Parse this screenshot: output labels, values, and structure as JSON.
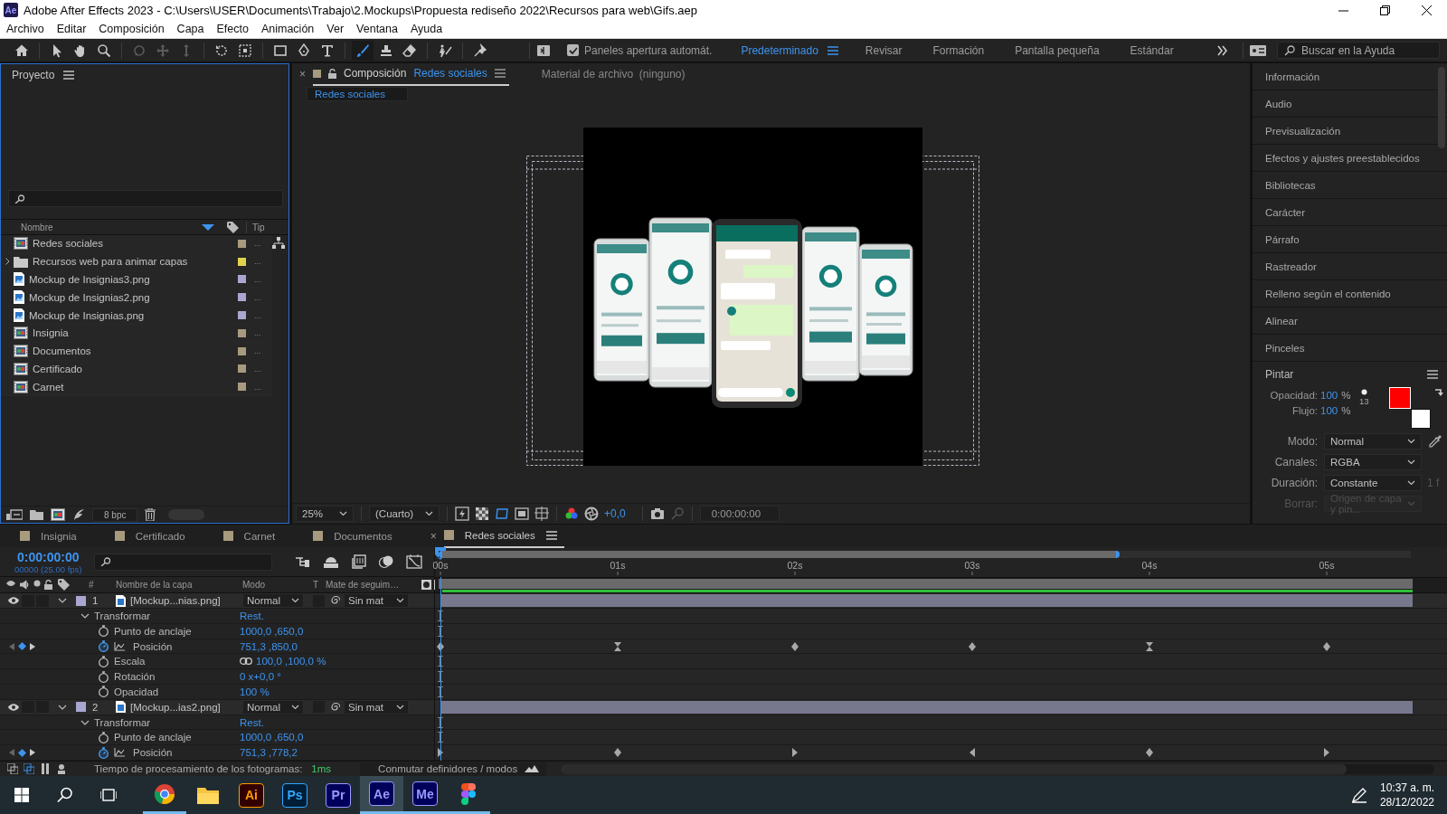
{
  "window": {
    "app_badge": "Ae",
    "title": "Adobe After Effects 2023 - C:\\Users\\USER\\Documents\\Trabajo\\2.Mockups\\Propuesta rediseño 2022\\Recursos para web\\Gifs.aep"
  },
  "menu": [
    "Archivo",
    "Editar",
    "Composición",
    "Capa",
    "Efecto",
    "Animación",
    "Ver",
    "Ventana",
    "Ayuda"
  ],
  "toolbar": {
    "tools": [
      {
        "kind": "home",
        "selected": false,
        "disabled": false
      },
      {
        "kind": "selection",
        "selected": false,
        "disabled": false
      },
      {
        "kind": "hand",
        "selected": false,
        "disabled": false
      },
      {
        "kind": "zoom",
        "selected": false,
        "disabled": false
      },
      {
        "kind": "orbit",
        "selected": false,
        "disabled": true
      },
      {
        "kind": "pan",
        "selected": false,
        "disabled": true
      },
      {
        "kind": "dolly",
        "selected": false,
        "disabled": true
      },
      {
        "kind": "rotate",
        "selected": false,
        "disabled": false
      },
      {
        "kind": "pan-behind",
        "selected": false,
        "disabled": false
      },
      {
        "kind": "rectangle",
        "selected": false,
        "disabled": false
      },
      {
        "kind": "pen",
        "selected": false,
        "disabled": false
      },
      {
        "kind": "type",
        "selected": false,
        "disabled": false
      },
      {
        "kind": "brush",
        "selected": true,
        "disabled": false
      },
      {
        "kind": "stamp",
        "selected": false,
        "disabled": false
      },
      {
        "kind": "eraser",
        "selected": false,
        "disabled": false
      },
      {
        "kind": "roto",
        "selected": false,
        "disabled": false
      },
      {
        "kind": "puppet",
        "selected": false,
        "disabled": false
      }
    ],
    "auto_open": {
      "label": "Paneles apertura automát.",
      "checked": true
    },
    "workspaces": [
      {
        "label": "Predeterminado",
        "selected": true
      },
      {
        "label": "Revisar",
        "selected": false
      },
      {
        "label": "Formación",
        "selected": false
      },
      {
        "label": "Pantalla pequeña",
        "selected": false
      },
      {
        "label": "Estándar",
        "selected": false
      }
    ],
    "search": {
      "placeholder": "Buscar en la Ayuda"
    }
  },
  "project": {
    "title": "Proyecto",
    "columns": [
      "Nombre",
      "Tip"
    ],
    "bit_depth": "8 bpc",
    "thumbnail_slider": {
      "level": 1
    },
    "items": [
      {
        "name": "Redes sociales",
        "kind": "composition",
        "color": "#a89a7e",
        "type": "...",
        "expandable": false
      },
      {
        "name": "Recursos web para animar capas",
        "kind": "folder",
        "color": "#e2d34c",
        "type": "...",
        "expandable": true
      },
      {
        "name": "Mockup de Insignias3.png",
        "kind": "image",
        "color": "#aaa6d2",
        "type": "...",
        "expandable": false
      },
      {
        "name": "Mockup de Insignias2.png",
        "kind": "image",
        "color": "#aaa6d2",
        "type": "...",
        "expandable": false
      },
      {
        "name": "Mockup de Insignias.png",
        "kind": "image",
        "color": "#aaa6d2",
        "type": "...",
        "expandable": false
      },
      {
        "name": "Insignia",
        "kind": "composition",
        "color": "#a89a7e",
        "type": "...",
        "expandable": false
      },
      {
        "name": "Documentos",
        "kind": "composition",
        "color": "#a89a7e",
        "type": "...",
        "expandable": false
      },
      {
        "name": "Certificado",
        "kind": "composition",
        "color": "#a89a7e",
        "type": "...",
        "expandable": false
      },
      {
        "name": "Carnet",
        "kind": "composition",
        "color": "#a89a7e",
        "type": "...",
        "expandable": false
      }
    ]
  },
  "composition": {
    "close": "×",
    "tab": {
      "label": "Composición",
      "name": "Redes sociales",
      "color": "#a89a7e"
    },
    "footage_tab": "Material de archivo  (ninguno)",
    "breadcrumb": "Redes sociales",
    "viewer": {
      "zoom": "25%",
      "resolution": "(Cuarto)",
      "exposure": "+0,0",
      "timecode": "0:00:00:00"
    }
  },
  "panels": {
    "items": [
      "Información",
      "Audio",
      "Previsualización",
      "Efectos y ajustes preestablecidos",
      "Bibliotecas",
      "Carácter",
      "Párrafo",
      "Rastreador",
      "Relleno según el contenido",
      "Alinear",
      "Pinceles"
    ],
    "paint": {
      "title": "Pintar",
      "opacity_label": "Opacidad:",
      "opacity": "100",
      "flow_label": "Flujo:",
      "flow": "100",
      "unit": "%",
      "brush_size": "13",
      "colors": [
        {
          "kind": "foreground",
          "color": "#ff0000"
        },
        {
          "kind": "background",
          "color": "#ffffff"
        }
      ],
      "fields": [
        {
          "label": "Modo:",
          "value": "Normal",
          "disabled": false
        },
        {
          "label": "Canales:",
          "value": "RGBA",
          "disabled": false
        },
        {
          "label": "Duración:",
          "value": "Constante",
          "suffix": "1 f",
          "disabled": false
        },
        {
          "label": "Borrar:",
          "value": "Origen de capa y pin...",
          "disabled": true
        }
      ]
    }
  },
  "timeline": {
    "tabs": [
      {
        "label": "Insignia",
        "color": "#a89a7e",
        "selected": false
      },
      {
        "label": "Certificado",
        "color": "#a89a7e",
        "selected": false
      },
      {
        "label": "Carnet",
        "color": "#a89a7e",
        "selected": false
      },
      {
        "label": "Documentos",
        "color": "#a89a7e",
        "selected": false
      },
      {
        "label": "Redes sociales",
        "color": "#a89a7e",
        "selected": true,
        "close": "×"
      }
    ],
    "timecode": "0:00:00:00",
    "frame_info": "00000 (25.00 fps)",
    "columns": {
      "number": "#",
      "name": "Nombre de la capa",
      "mode": "Modo",
      "t": "T",
      "matte": "Mate de seguim…"
    },
    "ruler": [
      "00s",
      "01s",
      "02s",
      "03s",
      "04s",
      "05s"
    ],
    "navigator": {
      "level": 0.7
    },
    "layers": [
      {
        "number": "1",
        "name": "[Mockup...nias.png]",
        "color": "#aaa6d2",
        "visible": true,
        "expanded": true,
        "mode": "Normal",
        "matte": "Sin mat",
        "children": [
          {
            "name": "Transformar",
            "value": "Rest.",
            "expanded": true,
            "keys": [
              {
                "kind": "bar"
              }
            ],
            "children": [
              {
                "name": "Punto de anclaje",
                "value": "1000,0 ,650,0",
                "animated": false,
                "keys": [
                  {
                    "kind": "bar"
                  }
                ]
              },
              {
                "name": "Posición",
                "value": "751,3 ,850,0",
                "animated": true,
                "keys": [
                  {
                    "kind": "diamond"
                  },
                  {
                    "kind": "hourglass"
                  },
                  {
                    "kind": "diamond"
                  },
                  {
                    "kind": "diamond"
                  },
                  {
                    "kind": "hourglass"
                  },
                  {
                    "kind": "diamond"
                  }
                ]
              },
              {
                "name": "Escala",
                "value": "100,0 ,100,0 %",
                "animated": false,
                "linked": true,
                "keys": [
                  {
                    "kind": "bar"
                  }
                ]
              },
              {
                "name": "Rotación",
                "value": "0 x+0,0 °",
                "animated": false,
                "keys": [
                  {
                    "kind": "bar"
                  }
                ]
              },
              {
                "name": "Opacidad",
                "value": "100 %",
                "animated": false,
                "keys": [
                  {
                    "kind": "bar"
                  }
                ]
              }
            ]
          }
        ]
      },
      {
        "number": "2",
        "name": "[Mockup...ias2.png]",
        "color": "#aaa6d2",
        "visible": true,
        "expanded": true,
        "mode": "Normal",
        "matte": "Sin mat",
        "children": [
          {
            "name": "Transformar",
            "value": "Rest.",
            "expanded": true,
            "keys": [
              {
                "kind": "bar"
              }
            ],
            "children": [
              {
                "name": "Punto de anclaje",
                "value": "1000,0 ,650,0",
                "animated": false,
                "keys": [
                  {
                    "kind": "bar"
                  }
                ]
              },
              {
                "name": "Posición",
                "value": "751,3 ,778,2",
                "animated": true,
                "keys": [
                  {
                    "kind": "ease-out"
                  },
                  {
                    "kind": "diamond"
                  },
                  {
                    "kind": "ease-out"
                  },
                  {
                    "kind": "ease-in"
                  },
                  {
                    "kind": "diamond"
                  },
                  {
                    "kind": "ease-out"
                  }
                ]
              }
            ]
          }
        ]
      }
    ],
    "zoom_slider": {
      "level": 0.9
    },
    "status": {
      "render_label": "Tiempo de procesamiento de los fotogramas:",
      "render_time": "1ms",
      "toggle": "Conmutar definidores / modos"
    }
  },
  "taskbar": {
    "apps": [
      {
        "kind": "chrome",
        "running": true,
        "selected": false
      },
      {
        "kind": "folder",
        "running": false,
        "selected": false
      },
      {
        "kind": "badge",
        "label": "Ai",
        "color": "#ff9a00",
        "running": false,
        "selected": false
      },
      {
        "kind": "badge",
        "label": "Ps",
        "color": "#31a8ff",
        "running": false,
        "selected": false
      },
      {
        "kind": "badge",
        "label": "Pr",
        "color": "#9999ff",
        "running": false,
        "selected": false
      },
      {
        "kind": "badge",
        "label": "Ae",
        "color": "#9999ff",
        "running": true,
        "selected": true
      },
      {
        "kind": "badge",
        "label": "Me",
        "color": "#9999ff",
        "running": true,
        "selected": false
      },
      {
        "kind": "figma",
        "running": true,
        "selected": false
      }
    ],
    "time": "10:37 a. m.",
    "date": "28/12/2022"
  }
}
